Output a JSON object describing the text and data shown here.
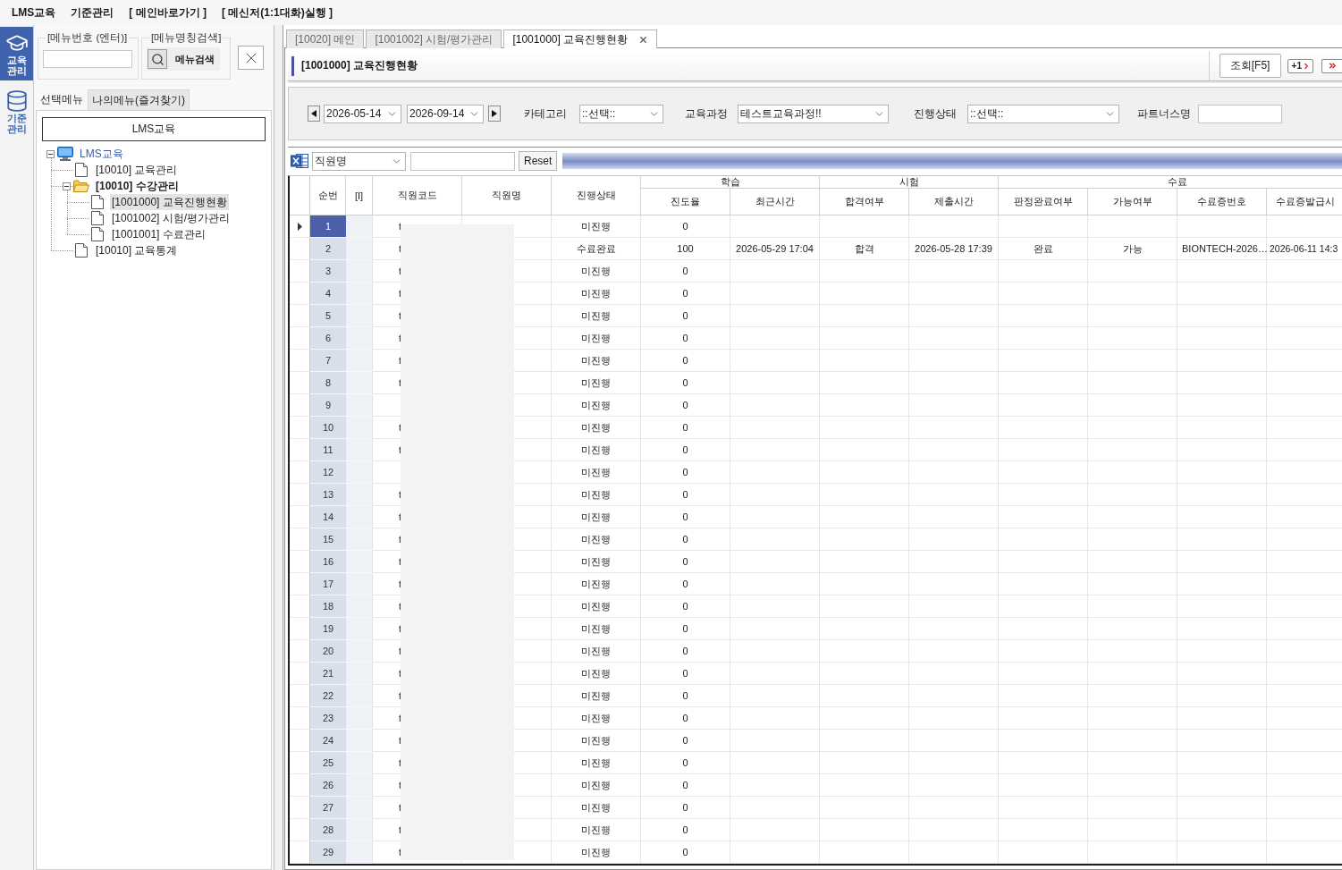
{
  "menu_bar": {
    "items": [
      "LMS교육",
      "기준관리",
      "[ 메인바로가기 ]",
      "[ 메신저(1:1대화)실행 ]"
    ]
  },
  "module_bar": {
    "items": [
      {
        "label": "교육관리",
        "kind": "education",
        "selected": true
      },
      {
        "label": "기준관리",
        "kind": "database",
        "selected": false
      }
    ]
  },
  "sidebar": {
    "menu_number": {
      "legend": "[메뉴번호 (엔터)]"
    },
    "menu_name_search": {
      "legend": "[메뉴명칭검색]",
      "button": "메뉴검색"
    },
    "tabs": [
      {
        "label": "선택메뉴",
        "selected": true
      },
      {
        "label": "나의메뉴(즐겨찾기)",
        "selected": false
      }
    ],
    "category": "LMS교육",
    "tree": [
      {
        "label": "LMS교육",
        "kind": "computer",
        "expanded": true,
        "selected": false,
        "children": [
          {
            "label": "[10010] 교육관리",
            "kind": "document",
            "selected": false
          },
          {
            "label": "[10010] 수강관리",
            "kind": "folder",
            "expanded": true,
            "selected": false,
            "children": [
              {
                "label": "[1001000] 교육진행현황",
                "kind": "document",
                "selected": true
              },
              {
                "label": "[1001002] 시험/평가관리",
                "kind": "document",
                "selected": false
              },
              {
                "label": "[1001001] 수료관리",
                "kind": "document",
                "selected": false
              }
            ]
          },
          {
            "label": "[10010] 교육통계",
            "kind": "document",
            "selected": false
          }
        ]
      }
    ]
  },
  "document_tabs": [
    {
      "label": "[10020] 메인",
      "selected": false,
      "closable": false
    },
    {
      "label": "[1001002] 시험/평가관리",
      "selected": false,
      "closable": false
    },
    {
      "label": "[1001000] 교육진행현황",
      "selected": true,
      "closable": true
    }
  ],
  "page": {
    "title": "[1001000] 교육진행현황",
    "buttons": [
      {
        "kind": "text",
        "label": "조회[F5]"
      },
      {
        "kind": "next",
        "label": "+1"
      },
      {
        "kind": "last"
      }
    ]
  },
  "filters": {
    "date_from": "2026-05-14",
    "date_to": "2026-09-14",
    "fields": [
      {
        "label": "카테고리",
        "kind": "select",
        "value": "::선택::"
      },
      {
        "label": "교육과정",
        "kind": "select",
        "value": "테스트교육과정!!"
      },
      {
        "label": "진행상태",
        "kind": "select",
        "value": "::선택::"
      },
      {
        "label": "파트너스명",
        "kind": "text"
      }
    ]
  },
  "grid_toolbar": {
    "search_column": "직원명",
    "reset_button": "Reset"
  },
  "table": {
    "columns": [
      {
        "label": "순번"
      },
      {
        "label": "[I]"
      },
      {
        "label": "직원코드"
      },
      {
        "label": "직원명"
      },
      {
        "label": "진행상태"
      },
      {
        "group": "학습",
        "columns": [
          {
            "label": "진도율"
          },
          {
            "label": "최근시간"
          }
        ]
      },
      {
        "group": "시험",
        "columns": [
          {
            "label": "합격여부"
          },
          {
            "label": "제출시간"
          }
        ]
      },
      {
        "group": "수료",
        "columns": [
          {
            "label": "판정완료여부"
          },
          {
            "label": "가능여부"
          },
          {
            "label": "수료증번호"
          },
          {
            "label": "수료증발급시"
          }
        ]
      }
    ],
    "rows": [
      {
        "selected": true,
        "no": "1",
        "code": "t",
        "status": "미진행",
        "progress": "0"
      },
      {
        "selected": false,
        "no": "2",
        "code": "t",
        "status": "수료완료",
        "progress": "100",
        "last_study_time": "2026-05-29 17:04",
        "pass_result": "합격",
        "submitted_time": "2026-05-28 17:39",
        "judgement": "완료",
        "eligibility": "가능",
        "certificate_no": "BIONTECH-2026…",
        "certificate_time": "2026-06-11 14:3"
      },
      {
        "selected": false,
        "no": "3",
        "code": "t",
        "status": "미진행",
        "progress": "0"
      },
      {
        "selected": false,
        "no": "4",
        "code": "t",
        "status": "미진행",
        "progress": "0"
      },
      {
        "selected": false,
        "no": "5",
        "code": "t",
        "status": "미진행",
        "progress": "0"
      },
      {
        "selected": false,
        "no": "6",
        "code": "t",
        "status": "미진행",
        "progress": "0"
      },
      {
        "selected": false,
        "no": "7",
        "code": "t",
        "status": "미진행",
        "progress": "0"
      },
      {
        "selected": false,
        "no": "8",
        "code": "t",
        "status": "미진행",
        "progress": "0"
      },
      {
        "selected": false,
        "no": "9",
        "status": "미진행",
        "progress": "0"
      },
      {
        "selected": false,
        "no": "10",
        "code": "t",
        "status": "미진행",
        "progress": "0"
      },
      {
        "selected": false,
        "no": "11",
        "code": "t",
        "status": "미진행",
        "progress": "0"
      },
      {
        "selected": false,
        "no": "12",
        "status": "미진행",
        "progress": "0"
      },
      {
        "selected": false,
        "no": "13",
        "code": "t",
        "status": "미진행",
        "progress": "0"
      },
      {
        "selected": false,
        "no": "14",
        "code": "t",
        "status": "미진행",
        "progress": "0"
      },
      {
        "selected": false,
        "no": "15",
        "code": "t",
        "status": "미진행",
        "progress": "0"
      },
      {
        "selected": false,
        "no": "16",
        "code": "t",
        "status": "미진행",
        "progress": "0"
      },
      {
        "selected": false,
        "no": "17",
        "code": "t",
        "status": "미진행",
        "progress": "0"
      },
      {
        "selected": false,
        "no": "18",
        "code": "t",
        "status": "미진행",
        "progress": "0"
      },
      {
        "selected": false,
        "no": "19",
        "code": "t",
        "status": "미진행",
        "progress": "0"
      },
      {
        "selected": false,
        "no": "20",
        "code": "t",
        "status": "미진행",
        "progress": "0"
      },
      {
        "selected": false,
        "no": "21",
        "code": "t",
        "status": "미진행",
        "progress": "0"
      },
      {
        "selected": false,
        "no": "22",
        "code": "t",
        "status": "미진행",
        "progress": "0"
      },
      {
        "selected": false,
        "no": "23",
        "code": "t",
        "status": "미진행",
        "progress": "0"
      },
      {
        "selected": false,
        "no": "24",
        "code": "t",
        "status": "미진행",
        "progress": "0"
      },
      {
        "selected": false,
        "no": "25",
        "code": "t",
        "status": "미진행",
        "progress": "0"
      },
      {
        "selected": false,
        "no": "26",
        "code": "t",
        "status": "미진행",
        "progress": "0"
      },
      {
        "selected": false,
        "no": "27",
        "code": "t",
        "status": "미진행",
        "progress": "0"
      },
      {
        "selected": false,
        "no": "28",
        "code": "t",
        "status": "미진행",
        "progress": "0"
      },
      {
        "selected": false,
        "no": "29",
        "code": "t",
        "status": "미진행",
        "progress": "0"
      }
    ]
  }
}
